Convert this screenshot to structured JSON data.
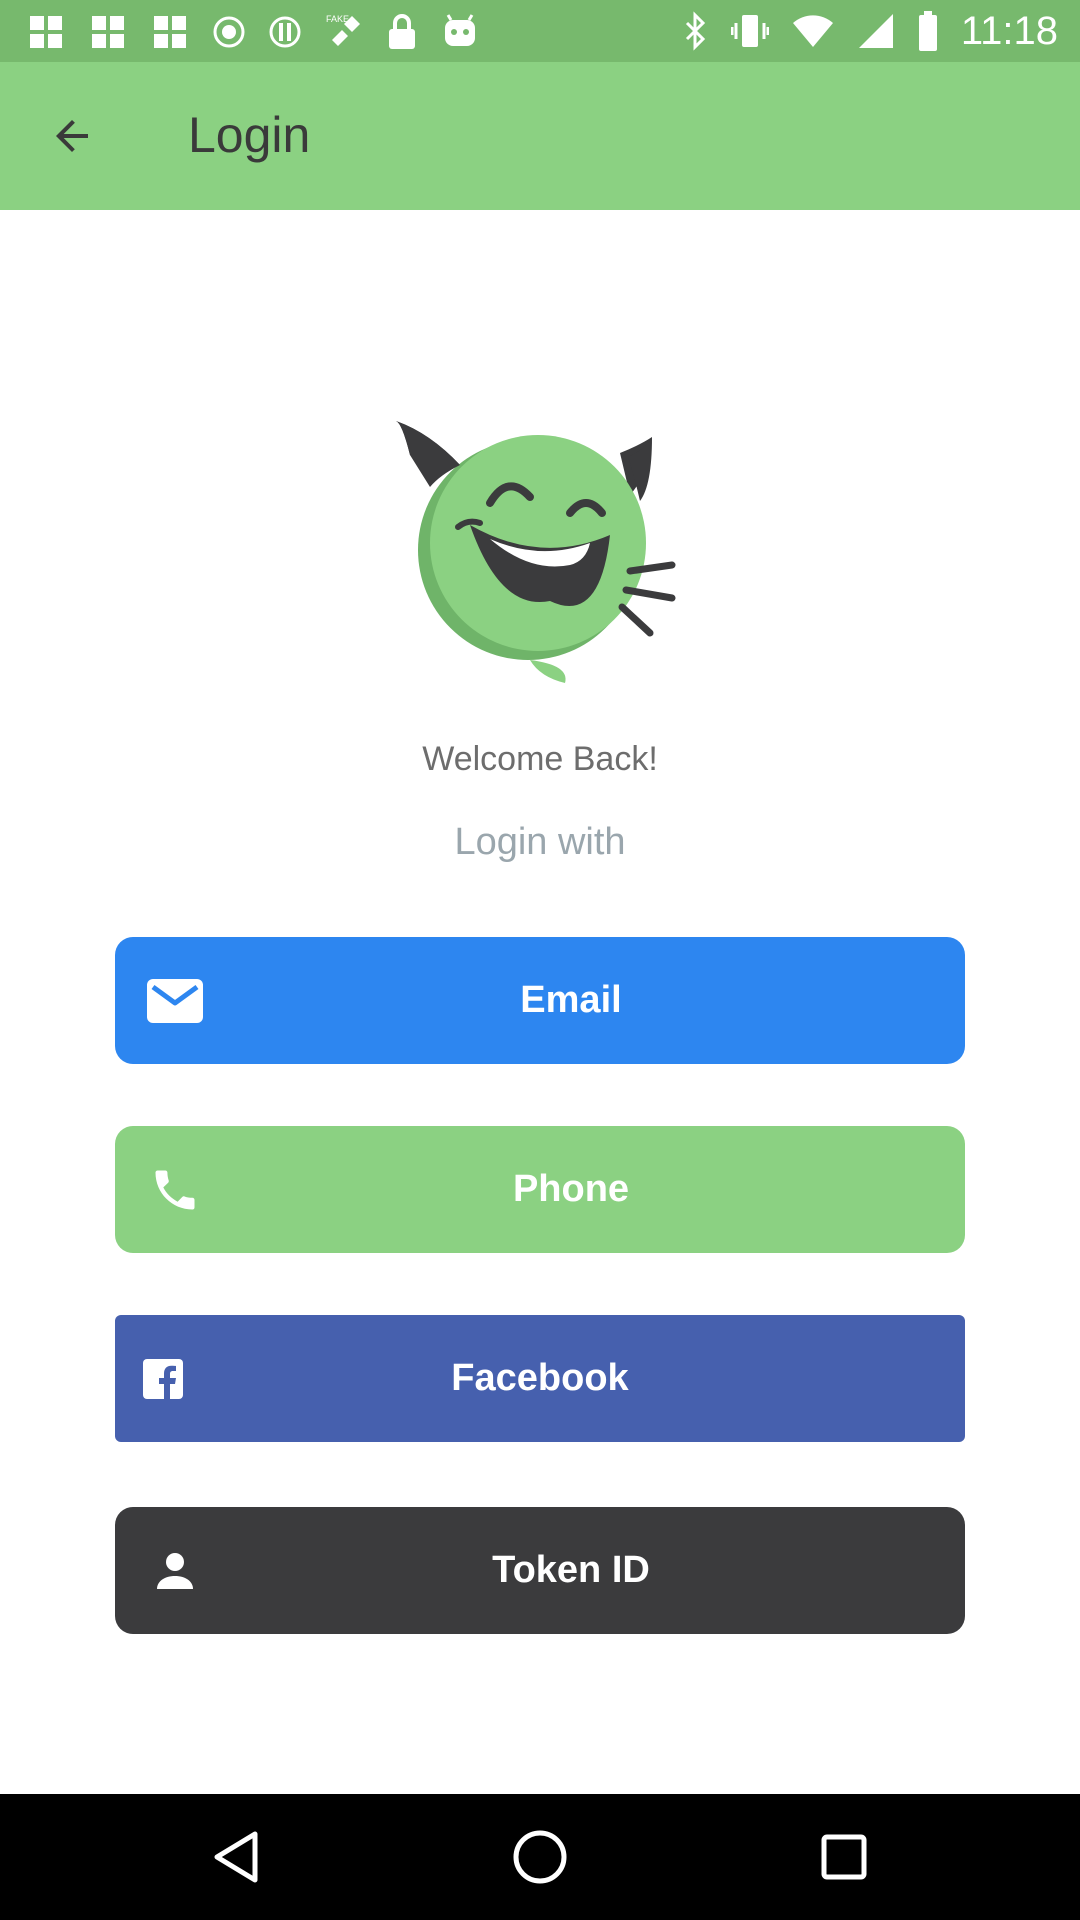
{
  "status_bar": {
    "time": "11:18",
    "left_icons": [
      "app-icon",
      "app-icon",
      "app-icon",
      "dot-circle-icon",
      "block-icon",
      "fake-satellite-icon",
      "lock-icon",
      "android-icon"
    ],
    "right_icons": [
      "bluetooth-icon",
      "vibrate-icon",
      "wifi-icon",
      "signal-icon",
      "battery-icon"
    ]
  },
  "toolbar": {
    "title": "Login",
    "back_icon": "arrow-back-icon"
  },
  "main": {
    "welcome": "Welcome Back!",
    "login_with": "Login with",
    "buttons": [
      {
        "label": "Email",
        "icon": "mail-icon",
        "color": "#2d86f0"
      },
      {
        "label": "Phone",
        "icon": "phone-icon",
        "color": "#8bd182"
      },
      {
        "label": "Facebook",
        "icon": "facebook-icon",
        "color": "#4660ae"
      },
      {
        "label": "Token ID",
        "icon": "person-icon",
        "color": "#3b3b3d"
      }
    ]
  },
  "nav_bar": {
    "items": [
      "back-triangle-icon",
      "home-circle-icon",
      "recents-square-icon"
    ]
  },
  "colors": {
    "status_bar": "#77b96d",
    "toolbar": "#8bd182",
    "mascot_green": "#8bd182",
    "mascot_dark": "#3b3b3d"
  }
}
